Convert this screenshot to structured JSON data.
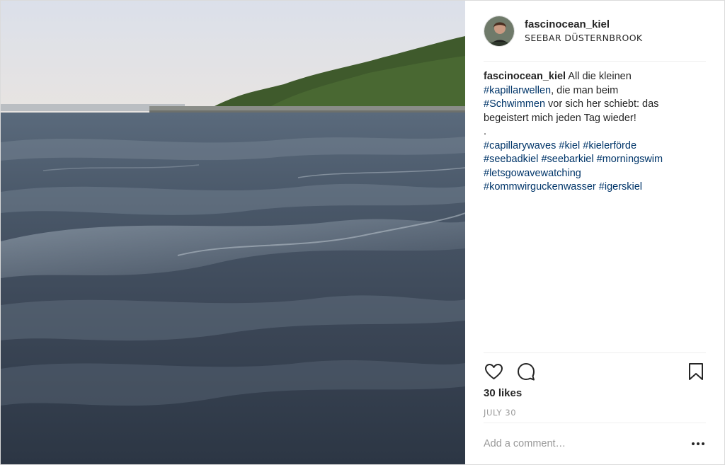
{
  "post": {
    "username": "fascinocean_kiel",
    "location": "SEEBAR DÜSTERNBROOK",
    "caption": {
      "username": "fascinocean_kiel",
      "line1": {
        "text_a": " All die kleinen",
        "tag_a": "#kapillarwellen",
        "text_b": ", die man beim",
        "tag_b": "#Schwimmen",
        "text_c": " vor sich her schiebt: das begeistert mich jeden Tag wieder!"
      },
      "dot": ".",
      "hashtags": [
        "#capillarywaves",
        "#kiel",
        "#kielerförde",
        "#seebadkiel",
        "#seebarkiel",
        "#morningswim",
        "#letsgowavewatching",
        "#kommwirguckenwasser",
        "#igerskiel"
      ]
    },
    "likes": "30 likes",
    "date": "JULY 30",
    "comment_placeholder": "Add a comment…"
  },
  "icons": {
    "like": "heart-icon",
    "comment": "comment-bubble-icon",
    "save": "bookmark-icon",
    "more": "more-options-icon"
  },
  "colors": {
    "hashtag": "#003569",
    "text": "#262626",
    "muted": "#999999",
    "divider": "#efefef"
  }
}
